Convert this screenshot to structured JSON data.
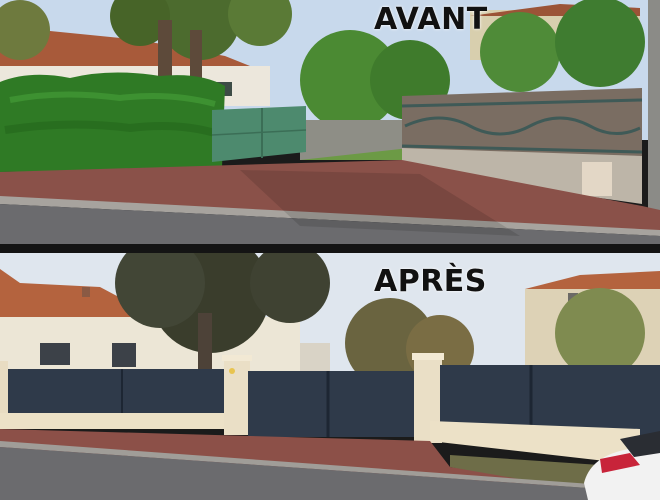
{
  "before": {
    "caption": "AVANT"
  },
  "after": {
    "caption": "APRÈS"
  },
  "colors": {
    "sky": "#c7d9ec",
    "roof": "#b4633e",
    "hedge": "#2f7a25",
    "old_gate": "#4d8a6e",
    "new_gate": "#2f3a4a",
    "wall": "#e9dcc3",
    "sidewalk": "#8c5048",
    "road": "#6b6b6e"
  }
}
